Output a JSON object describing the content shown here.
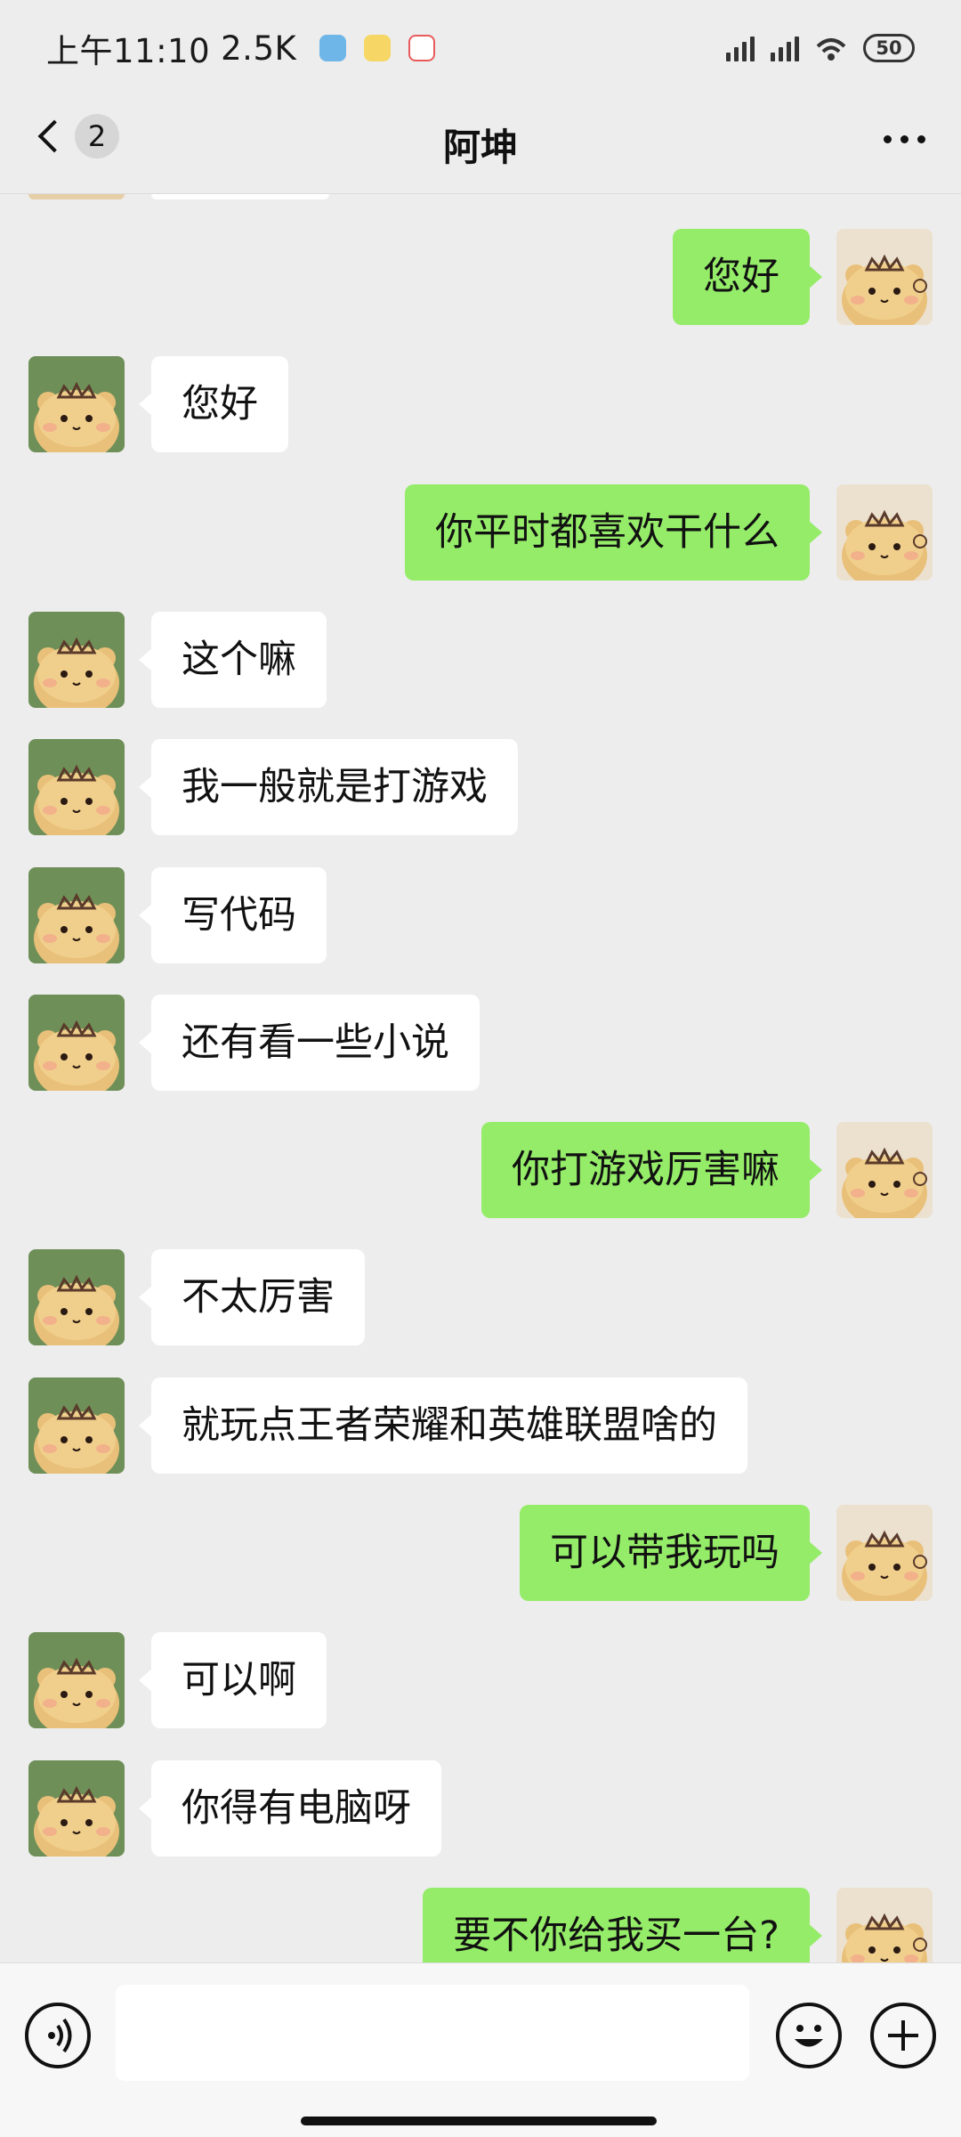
{
  "status_bar": {
    "time": "上午11:10",
    "speed": "2.5K",
    "battery": "50"
  },
  "header": {
    "unread_count": "2",
    "title": "阿坤"
  },
  "messages": [
    {
      "dir": "out",
      "text": "您好"
    },
    {
      "dir": "in",
      "text": "您好"
    },
    {
      "dir": "out",
      "text": "你平时都喜欢干什么"
    },
    {
      "dir": "in",
      "text": "这个嘛"
    },
    {
      "dir": "in",
      "text": "我一般就是打游戏"
    },
    {
      "dir": "in",
      "text": "写代码"
    },
    {
      "dir": "in",
      "text": "还有看一些小说"
    },
    {
      "dir": "out",
      "text": "你打游戏厉害嘛"
    },
    {
      "dir": "in",
      "text": "不太厉害"
    },
    {
      "dir": "in",
      "text": "就玩点王者荣耀和英雄联盟啥的"
    },
    {
      "dir": "out",
      "text": "可以带我玩吗"
    },
    {
      "dir": "in",
      "text": "可以啊"
    },
    {
      "dir": "in",
      "text": "你得有电脑呀"
    },
    {
      "dir": "out",
      "text": "要不你给我买一台?"
    }
  ],
  "composer": {
    "input_value": ""
  },
  "colors": {
    "background": "#ededed",
    "outgoing_bubble": "#95ec69",
    "incoming_bubble": "#ffffff",
    "contact_avatar_bg": "#6f8f58",
    "self_avatar_bg": "#ece1cf"
  }
}
